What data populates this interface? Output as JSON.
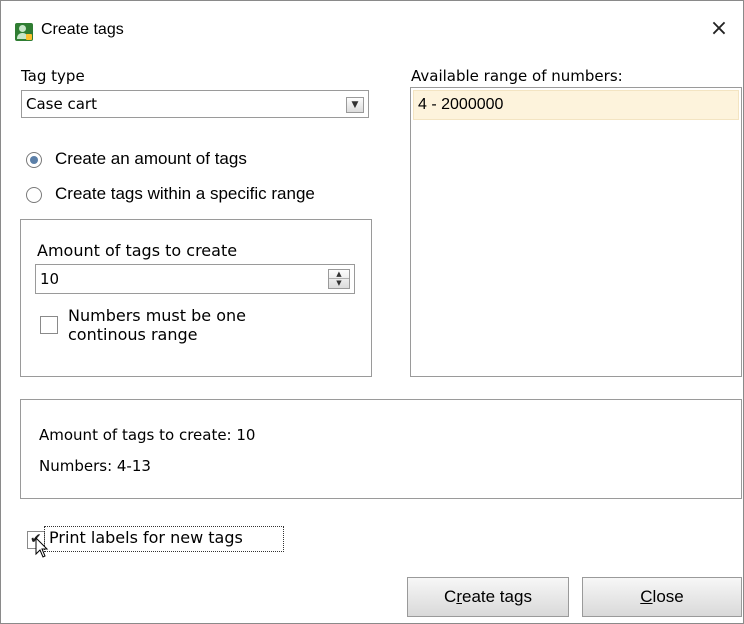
{
  "window": {
    "title": "Create tags",
    "close_glyph": "×",
    "app_icon": "user-tag-icon"
  },
  "tag_type": {
    "label": "Tag type",
    "selected": "Case cart",
    "arrow_glyph": "▼"
  },
  "mode": {
    "option_amount": "Create an amount of tags",
    "option_range": "Create tags within a specific range",
    "selected": "amount"
  },
  "amount_group": {
    "label": "Amount of tags to create",
    "value": "10",
    "up_glyph": "▲",
    "down_glyph": "▼",
    "continuous_line1": "Numbers must be one",
    "continuous_line2": "continous range",
    "continuous_checked": false
  },
  "available": {
    "label": "Available range of numbers:",
    "items": [
      "4 - 2000000"
    ]
  },
  "summary": {
    "amount_text": "Amount of tags to create: 10",
    "numbers_text": "Numbers:  4-13"
  },
  "print_labels": {
    "label": "Print labels for new tags",
    "checked": true
  },
  "buttons": {
    "create_pre": "C",
    "create_mnemonic": "r",
    "create_post": "eate tags",
    "close_mnemonic": "C",
    "close_post": "lose"
  },
  "colors": {
    "selected_row": "#fdf3dc",
    "radio_dot": "#5b7fa8",
    "app_icon": "#2f7d32"
  }
}
